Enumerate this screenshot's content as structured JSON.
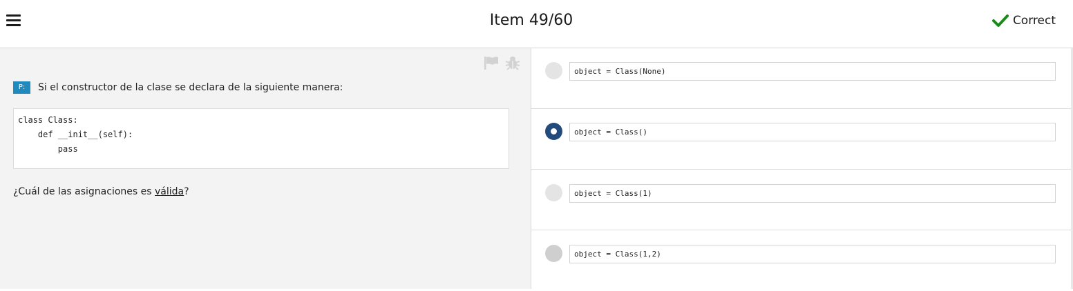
{
  "header": {
    "title": "Item 49/60",
    "status": {
      "label": "Correct",
      "color": "#1a8a1a"
    },
    "menu_icon": "hamburger-menu-icon"
  },
  "question_panel": {
    "tool_icons": [
      "flag-icon",
      "bug-icon"
    ],
    "badge": "P:",
    "prompt": "Si el constructor de la clase se declara de la siguiente manera:",
    "code": "class Class:\n    def __init__(self):\n        pass",
    "question_before": "¿Cuál de las asignaciones es ",
    "question_emphasis": "válida",
    "question_after": "?"
  },
  "options": [
    {
      "text": "object = Class(None)",
      "selected": false
    },
    {
      "text": "object = Class()",
      "selected": true
    },
    {
      "text": "object = Class(1)",
      "selected": false
    },
    {
      "text": "object = Class(1,2)",
      "selected": false
    }
  ],
  "colors": {
    "badge": "#1f8ac0",
    "selected_radio": "#244a7c",
    "left_pane_bg": "#f3f3f3"
  }
}
